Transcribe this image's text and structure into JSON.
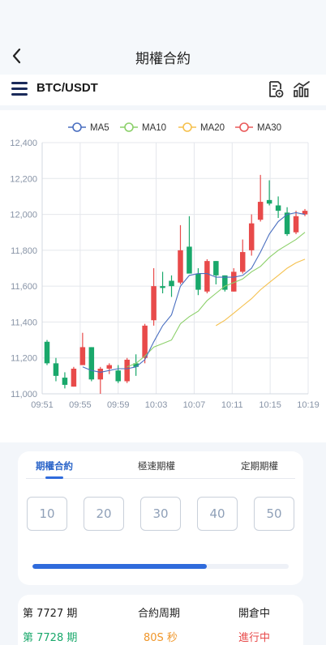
{
  "header": {
    "title": "期權合約",
    "back_icon": "chevron-left-icon"
  },
  "pairbar": {
    "pair": "BTC/USDT",
    "menu_icon": "hamburger-menu-icon",
    "icons": [
      "order-history-icon",
      "chart-stats-icon"
    ]
  },
  "chart_data": {
    "type": "candlestick",
    "legend": [
      {
        "name": "MA5",
        "color": "#4a6fc0"
      },
      {
        "name": "MA10",
        "color": "#8cd06a"
      },
      {
        "name": "MA20",
        "color": "#f5c14e"
      },
      {
        "name": "MA30",
        "color": "#ea5a5a"
      }
    ],
    "y_ticks": [
      "12,400",
      "12,200",
      "12,000",
      "11,800",
      "11,600",
      "11,400",
      "11,200",
      "11,000"
    ],
    "x_ticks": [
      "09:51",
      "09:55",
      "09:59",
      "10:03",
      "10:07",
      "10:11",
      "10:15",
      "10:19"
    ],
    "ylim": [
      11000,
      12400
    ],
    "up_color": "#e84a4a",
    "down_color": "#19a86b",
    "candles": [
      {
        "o": 11290,
        "h": 11300,
        "l": 11160,
        "c": 11170
      },
      {
        "o": 11170,
        "h": 11200,
        "l": 11070,
        "c": 11100
      },
      {
        "o": 11090,
        "h": 11120,
        "l": 11030,
        "c": 11050
      },
      {
        "o": 11040,
        "h": 11150,
        "l": 11040,
        "c": 11140
      },
      {
        "o": 11160,
        "h": 11340,
        "l": 11160,
        "c": 11260
      },
      {
        "o": 11260,
        "h": 11260,
        "l": 11070,
        "c": 11080
      },
      {
        "o": 11080,
        "h": 11150,
        "l": 11000,
        "c": 11140
      },
      {
        "o": 11140,
        "h": 11170,
        "l": 11110,
        "c": 11160
      },
      {
        "o": 11130,
        "h": 11160,
        "l": 11060,
        "c": 11070
      },
      {
        "o": 11070,
        "h": 11200,
        "l": 11060,
        "c": 11190
      },
      {
        "o": 11170,
        "h": 11220,
        "l": 11100,
        "c": 11150
      },
      {
        "o": 11200,
        "h": 11390,
        "l": 11170,
        "c": 11380
      },
      {
        "o": 11410,
        "h": 11700,
        "l": 11380,
        "c": 11600
      },
      {
        "o": 11600,
        "h": 11680,
        "l": 11560,
        "c": 11590
      },
      {
        "o": 11630,
        "h": 11660,
        "l": 11540,
        "c": 11600
      },
      {
        "o": 11620,
        "h": 11940,
        "l": 11610,
        "c": 11800
      },
      {
        "o": 11820,
        "h": 11990,
        "l": 11700,
        "c": 11670
      },
      {
        "o": 11670,
        "h": 11700,
        "l": 11550,
        "c": 11580
      },
      {
        "o": 11570,
        "h": 11750,
        "l": 11560,
        "c": 11740
      },
      {
        "o": 11740,
        "h": 11740,
        "l": 11610,
        "c": 11660
      },
      {
        "o": 11660,
        "h": 11660,
        "l": 11570,
        "c": 11580
      },
      {
        "o": 11570,
        "h": 11700,
        "l": 11570,
        "c": 11680
      },
      {
        "o": 11680,
        "h": 11860,
        "l": 11670,
        "c": 11790
      },
      {
        "o": 11800,
        "h": 12000,
        "l": 11770,
        "c": 11950
      },
      {
        "o": 11970,
        "h": 12220,
        "l": 11960,
        "c": 12070
      },
      {
        "o": 12080,
        "h": 12190,
        "l": 12050,
        "c": 12060
      },
      {
        "o": 12050,
        "h": 12100,
        "l": 11980,
        "c": 12020
      },
      {
        "o": 12010,
        "h": 12040,
        "l": 11880,
        "c": 11890
      },
      {
        "o": 11900,
        "h": 12020,
        "l": 11890,
        "c": 11990
      },
      {
        "o": 12000,
        "h": 12030,
        "l": 11990,
        "c": 12020
      }
    ],
    "ma5": [
      null,
      null,
      null,
      null,
      11150,
      11130,
      11120,
      11130,
      11140,
      11140,
      11150,
      11190,
      11290,
      11380,
      11440,
      11600,
      11660,
      11670,
      11670,
      11650,
      11650,
      11650,
      11660,
      11700,
      11790,
      11890,
      11960,
      12000,
      12010,
      12000
    ],
    "ma10": [
      null,
      null,
      null,
      null,
      null,
      null,
      null,
      null,
      null,
      11150,
      11170,
      11210,
      11260,
      11280,
      11300,
      11390,
      11430,
      11460,
      11520,
      11560,
      11600,
      11620,
      11640,
      11680,
      11710,
      11760,
      11800,
      11830,
      11860,
      11900
    ],
    "ma20": [
      null,
      null,
      null,
      null,
      null,
      null,
      null,
      null,
      null,
      null,
      null,
      null,
      null,
      null,
      null,
      null,
      null,
      null,
      null,
      11380,
      11410,
      11450,
      11490,
      11530,
      11580,
      11620,
      11660,
      11700,
      11730,
      11750
    ],
    "ma30": []
  },
  "tabs": {
    "items": [
      "期權合約",
      "極速期權",
      "定期期權"
    ],
    "active": 0
  },
  "durations": [
    "10",
    "20",
    "30",
    "40",
    "50"
  ],
  "progress": {
    "percent": 68
  },
  "rows": [
    {
      "period": "第 7727 期",
      "cycle": "合約周期",
      "status": "開倉中"
    },
    {
      "period": "第 7728 期",
      "cycle": "80S 秒",
      "status": "進行中"
    }
  ],
  "colors": {
    "accent": "#2f6bdc",
    "green": "#19a86b",
    "orange": "#f0962a",
    "red": "#e84a4a"
  }
}
